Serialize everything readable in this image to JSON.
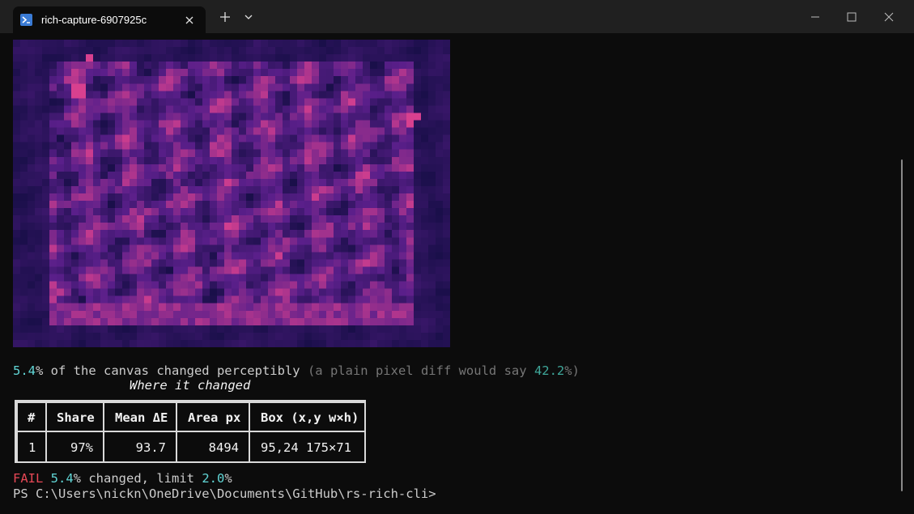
{
  "window": {
    "tab_title": "rich-capture-6907925c",
    "new_tab_label": "+",
    "icons": [
      "terminal-icon",
      "close-icon",
      "plus-icon",
      "chevron-down-icon",
      "minimize-icon",
      "maximize-icon",
      "window-close-icon"
    ]
  },
  "terminal": {
    "summary": {
      "pct": "5.4",
      "pct_sign": "%",
      "text": " of the canvas changed perceptibly ",
      "aside_open": "(a plain pixel diff would say ",
      "aside_pct": "42.2",
      "aside_close": "%)"
    },
    "table": {
      "caption": "Where it changed",
      "columns": [
        "#",
        "Share",
        "Mean ΔE",
        "Area px",
        "Box (x,y w×h)"
      ],
      "rows": [
        [
          "1",
          "97%",
          "93.7",
          "8494",
          "95,24 175×71"
        ]
      ]
    },
    "result": {
      "status": "FAIL",
      "pct": "5.4",
      "text1": "% changed, limit ",
      "limit": "2.0",
      "text2": "%"
    },
    "prompt": "PS C:\\Users\\nickn\\OneDrive\\Documents\\GitHub\\rs-rich-cli>"
  },
  "colors": {
    "heatmap_background": "#1a0f4a",
    "heatmap_mid": "#5a1f8a",
    "heatmap_hot": "#d8408f",
    "status_fail": "#e74856",
    "accent_cyan": "#61d6d6"
  }
}
